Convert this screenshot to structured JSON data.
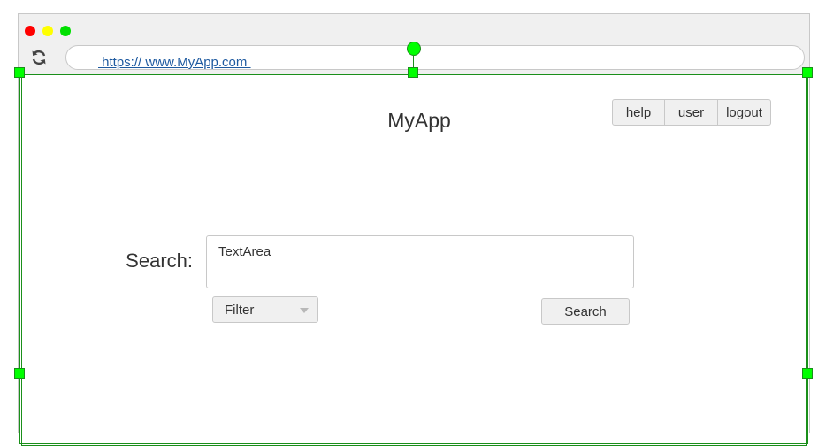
{
  "browser": {
    "url": " https:// www.MyApp.com ",
    "icons": {
      "close": "red-dot",
      "minimize": "yellow-dot",
      "maximize": "green-dot",
      "reload": "refresh-icon"
    }
  },
  "app": {
    "title": "MyApp"
  },
  "header_buttons": {
    "help": "help",
    "user": "user",
    "logout": "logout"
  },
  "search": {
    "label": "Search:",
    "textarea_value": "TextArea",
    "filter_label": "Filter",
    "button_label": "Search"
  },
  "colors": {
    "selection": "#00ff00",
    "selection_border": "#1a8f1a",
    "link": "#1e5aa0",
    "button_bg": "#f0f0f0"
  }
}
